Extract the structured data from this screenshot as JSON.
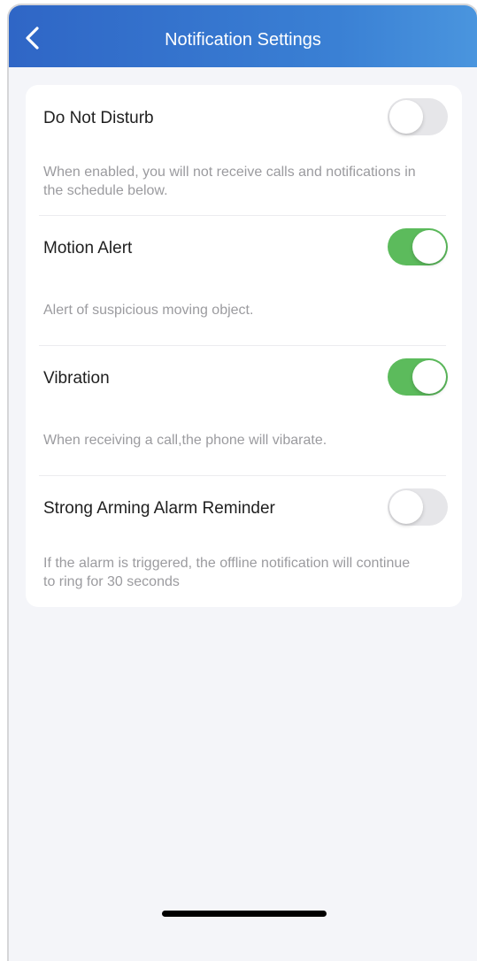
{
  "header": {
    "title": "Notification Settings",
    "back_icon": "chevron-left-icon"
  },
  "settings": [
    {
      "label": "Do Not Disturb",
      "description": "When enabled, you will not receive calls and notifications in the schedule below.",
      "enabled": false
    },
    {
      "label": "Motion Alert",
      "description": "Alert of suspicious moving object.",
      "enabled": true
    },
    {
      "label": "Vibration",
      "description": "When receiving a call,the phone will vibarate.",
      "enabled": true
    },
    {
      "label": "Strong Arming Alarm Reminder",
      "description": "If the alarm is triggered, the offline notification will continue to ring for 30 seconds",
      "enabled": false
    }
  ],
  "colors": {
    "header_start": "#2f66c6",
    "header_end": "#4a95de",
    "toggle_on": "#5cbb5c",
    "toggle_off": "#e6e6e9",
    "page_background": "#f4f5f9"
  }
}
